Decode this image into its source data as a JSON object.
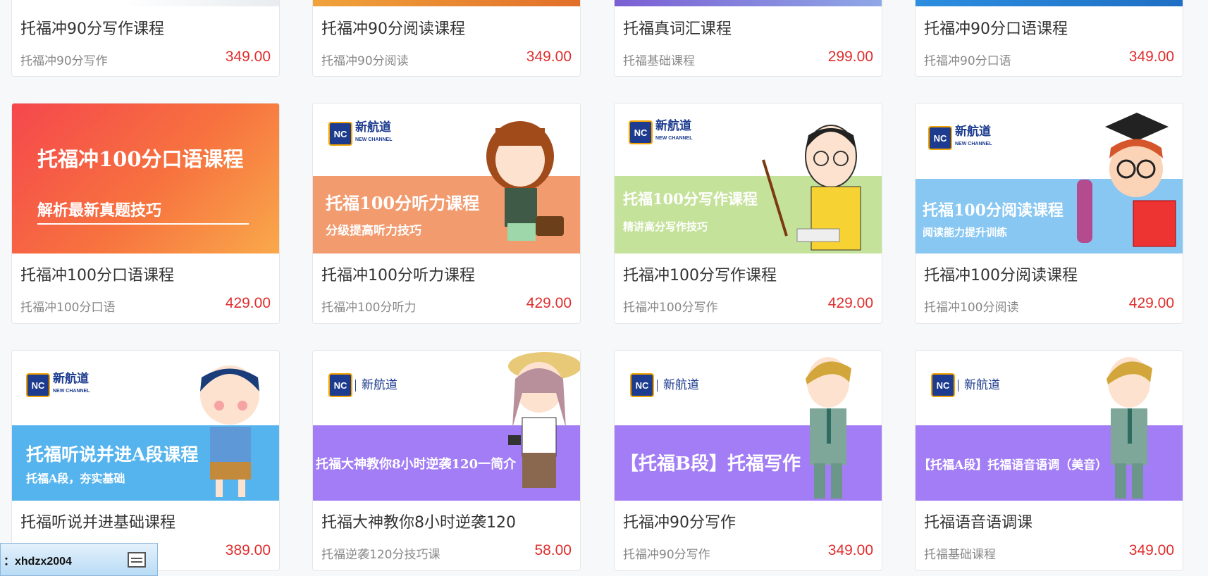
{
  "row1": [
    {
      "title": "托福冲90分写作课程",
      "sub": "托福冲90分写作",
      "price": "349.00"
    },
    {
      "title": "托福冲90分阅读课程",
      "sub": "托福冲90分阅读",
      "price": "349.00"
    },
    {
      "title": "托福真词汇课程",
      "sub": "托福基础课程",
      "price": "299.00"
    },
    {
      "title": "托福冲90分口语课程",
      "sub": "托福冲90分口语",
      "price": "349.00"
    }
  ],
  "row2": [
    {
      "title": "托福冲100分口语课程",
      "sub": "托福冲100分口语",
      "price": "429.00",
      "b1": "托福冲100分口语课程",
      "b2": "解析最新真题技巧"
    },
    {
      "title": "托福冲100分听力课程",
      "sub": "托福冲100分听力",
      "price": "429.00",
      "b1": "托福100分听力课程",
      "b2": "分级提高听力技巧"
    },
    {
      "title": "托福冲100分写作课程",
      "sub": "托福冲100分写作",
      "price": "429.00",
      "b1": "托福100分写作课程",
      "b2": "精讲高分写作技巧"
    },
    {
      "title": "托福冲100分阅读课程",
      "sub": "托福冲100分阅读",
      "price": "429.00",
      "b1": "托福100分阅读课程",
      "b2": "阅读能力提升训练"
    }
  ],
  "row3": [
    {
      "title": "托福听说并进基础课程",
      "sub": "",
      "price": "389.00",
      "b1": "托福听说并进A段课程",
      "b2": "托福A段，夯实基础"
    },
    {
      "title": "托福大神教你8小时逆袭120",
      "sub": "托福逆袭120分技巧课",
      "price": "58.00",
      "b1": "托福大神教你8小时逆袭120一简介"
    },
    {
      "title": "托福冲90分写作",
      "sub": "托福冲90分写作",
      "price": "349.00",
      "b1": "【托福B段】托福写作"
    },
    {
      "title": "托福语音语调课",
      "sub": "托福基础课程",
      "price": "349.00",
      "b1": "【托福A段】托福语音语调（美音）"
    }
  ],
  "logo": {
    "mark": "NC",
    "name": "新航道",
    "sub": "NEW CHANNEL"
  },
  "float_bar": {
    "text": "：xhdzx2004"
  },
  "colors": {
    "price": "#e02d2d",
    "purple": "#a27df5",
    "blue": "#55b4ee",
    "green": "#c5e29b",
    "orange": "#f29b6f",
    "red": "#f2544b"
  }
}
